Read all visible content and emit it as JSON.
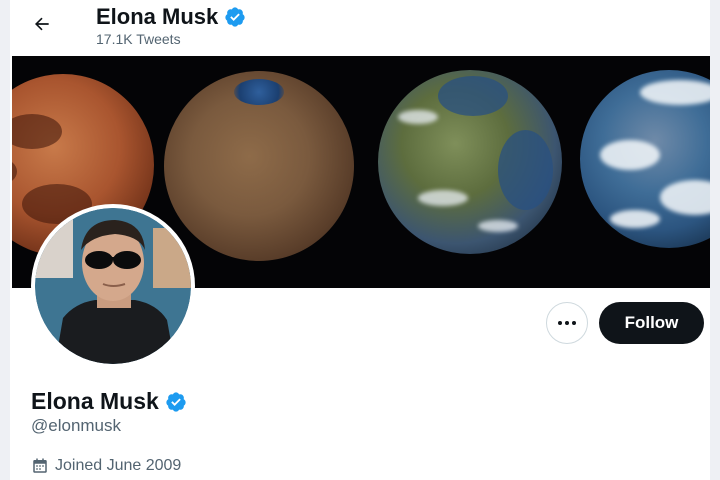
{
  "header": {
    "back_icon": "arrow-left-icon",
    "name": "Elona Musk",
    "tweet_count": "17.1K Tweets",
    "verified_icon": "verified-badge-icon"
  },
  "banner": {
    "description_icon": "planets-banner"
  },
  "profile": {
    "display_name": "Elona Musk",
    "handle": "@elonmusk",
    "joined": "Joined June 2009",
    "calendar_icon": "calendar-icon"
  },
  "actions": {
    "more_icon": "more-options-icon",
    "follow_label": "Follow"
  },
  "colors": {
    "verified": "#1d9bf0",
    "follow_bg": "#0f1419",
    "secondary_text": "#536471"
  }
}
